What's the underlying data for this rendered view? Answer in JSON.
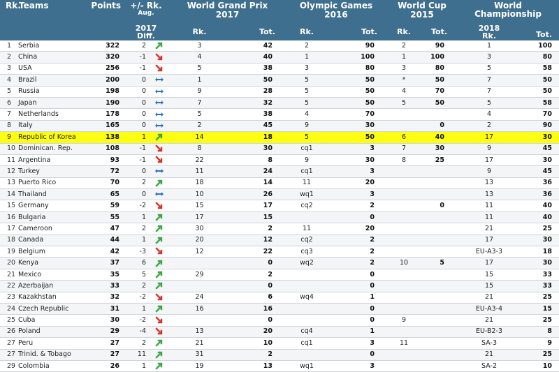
{
  "header": {
    "rk": "Rk.",
    "teams": "Teams",
    "points": "Points",
    "change_line1": "+/- Rk.",
    "change_line2": "Aug.",
    "change_line3": "2017",
    "diff": "Diff.",
    "wgp_line1": "World Grand Prix",
    "wgp_line2": "2017",
    "og_line1": "Olympic Games",
    "og_line2": "2016",
    "wc_line1": "World Cup",
    "wc_line2": "2015",
    "wch_line1": "World",
    "wch_line2": "Championship",
    "wch_line3": "2018",
    "sub_rk": "Rk.",
    "sub_tot": "Tot."
  },
  "colors": {
    "header_bg": "#3f6f8e",
    "highlight": "#ffff11",
    "up": "#3aa845",
    "down": "#d9332b",
    "same": "#2c72c7"
  },
  "rows": [
    {
      "rk": "1",
      "team": "Serbia",
      "points": "322",
      "diff": "2",
      "trend": "up",
      "wgp_rk": "3",
      "wgp_tot": "42",
      "og_rk": "2",
      "og_tot": "90",
      "wc_rk": "2",
      "wc_tot": "90",
      "wch_rk": "1",
      "wch_tot": "100"
    },
    {
      "rk": "2",
      "team": "China",
      "points": "320",
      "diff": "-1",
      "trend": "down",
      "wgp_rk": "4",
      "wgp_tot": "40",
      "og_rk": "1",
      "og_tot": "100",
      "wc_rk": "1",
      "wc_tot": "100",
      "wch_rk": "3",
      "wch_tot": "80"
    },
    {
      "rk": "3",
      "team": "USA",
      "points": "256",
      "diff": "-1",
      "trend": "down",
      "wgp_rk": "5",
      "wgp_tot": "38",
      "og_rk": "3",
      "og_tot": "80",
      "wc_rk": "3",
      "wc_tot": "80",
      "wch_rk": "5",
      "wch_tot": "58"
    },
    {
      "rk": "4",
      "team": "Brazil",
      "points": "200",
      "diff": "0",
      "trend": "same",
      "wgp_rk": "1",
      "wgp_tot": "50",
      "og_rk": "5",
      "og_tot": "50",
      "wc_rk": "*",
      "wc_tot": "50",
      "wch_rk": "7",
      "wch_tot": "50"
    },
    {
      "rk": "5",
      "team": "Russia",
      "points": "198",
      "diff": "0",
      "trend": "same",
      "wgp_rk": "9",
      "wgp_tot": "28",
      "og_rk": "5",
      "og_tot": "50",
      "wc_rk": "4",
      "wc_tot": "70",
      "wch_rk": "7",
      "wch_tot": "50"
    },
    {
      "rk": "6",
      "team": "Japan",
      "points": "190",
      "diff": "0",
      "trend": "same",
      "wgp_rk": "7",
      "wgp_tot": "32",
      "og_rk": "5",
      "og_tot": "50",
      "wc_rk": "5",
      "wc_tot": "50",
      "wch_rk": "5",
      "wch_tot": "58"
    },
    {
      "rk": "7",
      "team": "Netherlands",
      "points": "178",
      "diff": "0",
      "trend": "same",
      "wgp_rk": "5",
      "wgp_tot": "38",
      "og_rk": "4",
      "og_tot": "70",
      "wc_rk": "",
      "wc_tot": "",
      "wch_rk": "4",
      "wch_tot": "70"
    },
    {
      "rk": "8",
      "team": "Italy",
      "points": "165",
      "diff": "0",
      "trend": "same",
      "wgp_rk": "2",
      "wgp_tot": "45",
      "og_rk": "9",
      "og_tot": "30",
      "wc_rk": "",
      "wc_tot": "0",
      "wch_rk": "2",
      "wch_tot": "90"
    },
    {
      "rk": "9",
      "team": "Republic of Korea",
      "points": "138",
      "diff": "1",
      "trend": "up",
      "highlight": true,
      "wgp_rk": "14",
      "wgp_tot": "18",
      "og_rk": "5",
      "og_tot": "50",
      "wc_rk": "6",
      "wc_tot": "40",
      "wch_rk": "17",
      "wch_tot": "30"
    },
    {
      "rk": "10",
      "team": "Dominican. Rep.",
      "points": "108",
      "diff": "-1",
      "trend": "down",
      "wgp_rk": "8",
      "wgp_tot": "30",
      "og_rk": "cq1",
      "og_tot": "3",
      "wc_rk": "7",
      "wc_tot": "30",
      "wch_rk": "9",
      "wch_tot": "45"
    },
    {
      "rk": "11",
      "team": "Argentina",
      "points": "93",
      "diff": "-1",
      "trend": "down",
      "wgp_rk": "22",
      "wgp_tot": "8",
      "og_rk": "9",
      "og_tot": "30",
      "wc_rk": "8",
      "wc_tot": "25",
      "wch_rk": "17",
      "wch_tot": "30"
    },
    {
      "rk": "12",
      "team": "Turkey",
      "points": "72",
      "diff": "0",
      "trend": "same",
      "wgp_rk": "11",
      "wgp_tot": "24",
      "og_rk": "cq1",
      "og_tot": "3",
      "wc_rk": "",
      "wc_tot": "",
      "wch_rk": "9",
      "wch_tot": "45"
    },
    {
      "rk": "13",
      "team": "Puerto Rico",
      "points": "70",
      "diff": "2",
      "trend": "up",
      "wgp_rk": "18",
      "wgp_tot": "14",
      "og_rk": "11",
      "og_tot": "20",
      "wc_rk": "",
      "wc_tot": "",
      "wch_rk": "13",
      "wch_tot": "36"
    },
    {
      "rk": "14",
      "team": "Thailand",
      "points": "65",
      "diff": "0",
      "trend": "same",
      "wgp_rk": "10",
      "wgp_tot": "26",
      "og_rk": "wq1",
      "og_tot": "3",
      "wc_rk": "",
      "wc_tot": "",
      "wch_rk": "13",
      "wch_tot": "36"
    },
    {
      "rk": "15",
      "team": "Germany",
      "points": "59",
      "diff": "-2",
      "trend": "down",
      "wgp_rk": "15",
      "wgp_tot": "17",
      "og_rk": "cq2",
      "og_tot": "2",
      "wc_rk": "",
      "wc_tot": "0",
      "wch_rk": "11",
      "wch_tot": "40"
    },
    {
      "rk": "16",
      "team": "Bulgaria",
      "points": "55",
      "diff": "1",
      "trend": "up",
      "wgp_rk": "17",
      "wgp_tot": "15",
      "og_rk": "",
      "og_tot": "0",
      "wc_rk": "",
      "wc_tot": "",
      "wch_rk": "11",
      "wch_tot": "40"
    },
    {
      "rk": "17",
      "team": "Cameroon",
      "points": "47",
      "diff": "2",
      "trend": "up",
      "wgp_rk": "30",
      "wgp_tot": "2",
      "og_rk": "11",
      "og_tot": "20",
      "wc_rk": "",
      "wc_tot": "",
      "wch_rk": "21",
      "wch_tot": "25"
    },
    {
      "rk": "18",
      "team": "Canada",
      "points": "44",
      "diff": "1",
      "trend": "up",
      "wgp_rk": "20",
      "wgp_tot": "12",
      "og_rk": "cq2",
      "og_tot": "2",
      "wc_rk": "",
      "wc_tot": "",
      "wch_rk": "17",
      "wch_tot": "30"
    },
    {
      "rk": "19",
      "team": "Belgium",
      "points": "42",
      "diff": "-3",
      "trend": "down",
      "wgp_rk": "12",
      "wgp_tot": "22",
      "og_rk": "cq3",
      "og_tot": "2",
      "wc_rk": "",
      "wc_tot": "",
      "wch_rk": "EU-A3-3",
      "wch_tot": "18"
    },
    {
      "rk": "20",
      "team": "Kenya",
      "points": "37",
      "diff": "6",
      "trend": "up",
      "wgp_rk": "",
      "wgp_tot": "0",
      "og_rk": "wq2",
      "og_tot": "2",
      "wc_rk": "10",
      "wc_tot": "5",
      "wch_rk": "17",
      "wch_tot": "30"
    },
    {
      "rk": "21",
      "team": "Mexico",
      "points": "35",
      "diff": "5",
      "trend": "up",
      "wgp_rk": "29",
      "wgp_tot": "2",
      "og_rk": "",
      "og_tot": "0",
      "wc_rk": "",
      "wc_tot": "",
      "wch_rk": "15",
      "wch_tot": "33"
    },
    {
      "rk": "22",
      "team": "Azerbaijan",
      "points": "33",
      "diff": "2",
      "trend": "up",
      "wgp_rk": "",
      "wgp_tot": "0",
      "og_rk": "",
      "og_tot": "0",
      "wc_rk": "",
      "wc_tot": "",
      "wch_rk": "15",
      "wch_tot": "33"
    },
    {
      "rk": "23",
      "team": "Kazakhstan",
      "points": "32",
      "diff": "-2",
      "trend": "down",
      "wgp_rk": "24",
      "wgp_tot": "6",
      "og_rk": "wq4",
      "og_tot": "1",
      "wc_rk": "",
      "wc_tot": "",
      "wch_rk": "21",
      "wch_tot": "25"
    },
    {
      "rk": "24",
      "team": "Czech Republic",
      "points": "31",
      "diff": "1",
      "trend": "up",
      "wgp_rk": "16",
      "wgp_tot": "16",
      "og_rk": "",
      "og_tot": "0",
      "wc_rk": "",
      "wc_tot": "",
      "wch_rk": "EU-A3-4",
      "wch_tot": "15"
    },
    {
      "rk": "25",
      "team": "Cuba",
      "points": "30",
      "diff": "-2",
      "trend": "down",
      "wgp_rk": "",
      "wgp_tot": "0",
      "og_rk": "",
      "og_tot": "0",
      "wc_rk": "9",
      "wc_tot": "",
      "wch_rk": "21",
      "wch_tot": "25"
    },
    {
      "rk": "26",
      "team": "Poland",
      "points": "29",
      "diff": "-4",
      "trend": "down",
      "wgp_rk": "13",
      "wgp_tot": "20",
      "og_rk": "cq4",
      "og_tot": "1",
      "wc_rk": "",
      "wc_tot": "",
      "wch_rk": "EU-B2-3",
      "wch_tot": "8"
    },
    {
      "rk": "27",
      "team": "Peru",
      "points": "27",
      "diff": "2",
      "trend": "up",
      "wgp_rk": "21",
      "wgp_tot": "10",
      "og_rk": "cq1",
      "og_tot": "3",
      "wc_rk": "11",
      "wc_tot": "",
      "wch_rk": "SA-3",
      "wch_tot": "9"
    },
    {
      "rk": "27",
      "team": "Trinid. & Tobago",
      "points": "27",
      "diff": "11",
      "trend": "up",
      "wgp_rk": "31",
      "wgp_tot": "2",
      "og_rk": "",
      "og_tot": "0",
      "wc_rk": "",
      "wc_tot": "",
      "wch_rk": "21",
      "wch_tot": "25"
    },
    {
      "rk": "29",
      "team": "Colombia",
      "points": "26",
      "diff": "1",
      "trend": "up",
      "wgp_rk": "19",
      "wgp_tot": "13",
      "og_rk": "wq1",
      "og_tot": "3",
      "wc_rk": "",
      "wc_tot": "",
      "wch_rk": "SA-2",
      "wch_tot": "10"
    }
  ]
}
